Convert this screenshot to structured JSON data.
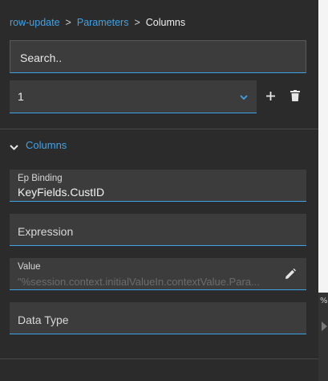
{
  "breadcrumb": {
    "items": [
      "row-update",
      "Parameters"
    ],
    "separator": ">",
    "current": "Columns"
  },
  "search": {
    "placeholder": "Search..",
    "icon": "none"
  },
  "param_select": {
    "selected": "1",
    "icon": "chevron-down-icon"
  },
  "actions": {
    "add_icon": "plus-icon",
    "delete_icon": "trash-icon"
  },
  "section": {
    "title": "Columns",
    "expanded": true
  },
  "fields": {
    "ep_binding": {
      "label": "Ep Binding",
      "value": "KeyFields.CustID"
    },
    "expression": {
      "label": "Expression",
      "value": ""
    },
    "value": {
      "label": "Value",
      "placeholder": "\"%session.context.initialValueIn.contextValue.Para...",
      "icon": "pencil-icon"
    },
    "data_type": {
      "label": "Data Type",
      "value": ""
    }
  },
  "right_edge": {
    "glyph": "%"
  },
  "colors": {
    "accent": "#3fa3e8",
    "panel_bg": "#2b2b2b",
    "field_bg": "#3c3c3c"
  }
}
